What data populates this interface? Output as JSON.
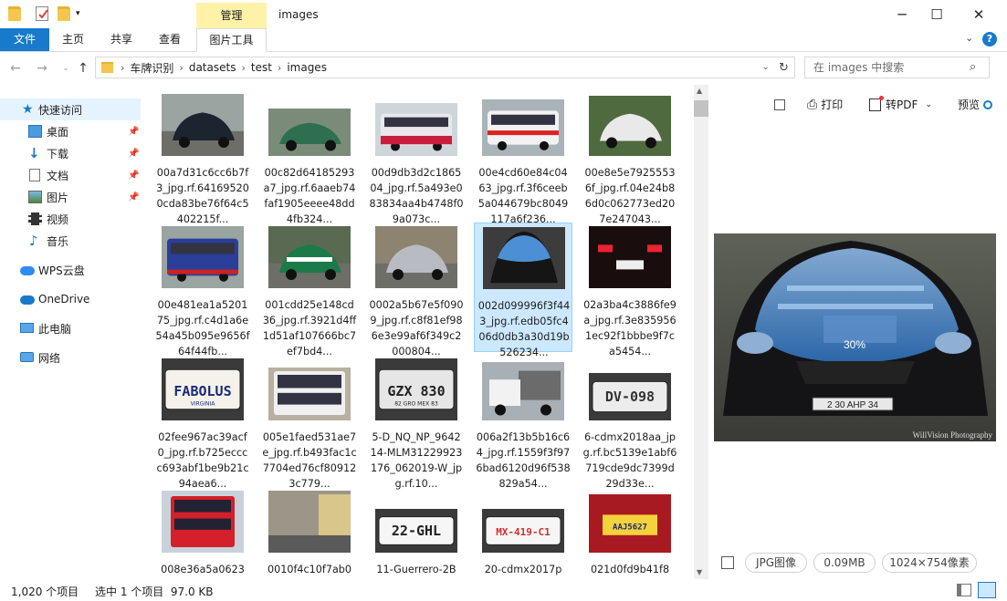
{
  "window": {
    "title": "images",
    "context_tab": "管理",
    "controls": [
      "─",
      "☐",
      "✕"
    ]
  },
  "ribbon": {
    "tabs": [
      "文件",
      "主页",
      "共享",
      "查看",
      "图片工具"
    ]
  },
  "address": {
    "crumbs": [
      "车牌识别",
      "datasets",
      "test",
      "images"
    ],
    "search_placeholder": "在 images 中搜索"
  },
  "sidebar": {
    "items": [
      {
        "label": "快速访问",
        "icon": "star-icon",
        "pinned": false
      },
      {
        "label": "桌面",
        "icon": "desktop-icon",
        "pinned": true
      },
      {
        "label": "下载",
        "icon": "download-icon",
        "pinned": true
      },
      {
        "label": "文档",
        "icon": "document-icon",
        "pinned": true
      },
      {
        "label": "图片",
        "icon": "picture-icon",
        "pinned": true
      },
      {
        "label": "视频",
        "icon": "video-icon",
        "pinned": false
      },
      {
        "label": "音乐",
        "icon": "music-icon",
        "pinned": false
      },
      {
        "label": "WPS云盘",
        "icon": "cloud-icon",
        "pinned": false
      },
      {
        "label": "OneDrive",
        "icon": "onedrive-icon",
        "pinned": false
      },
      {
        "label": "此电脑",
        "icon": "computer-icon",
        "pinned": false
      },
      {
        "label": "网络",
        "icon": "network-icon",
        "pinned": false
      }
    ]
  },
  "files": [
    {
      "name": "00a7d31c6cc6b7f3_jpg.rf.641695200cda83be76f64c5402215f...",
      "thumb": "car-dark"
    },
    {
      "name": "00c82d64185293a7_jpg.rf.6aaeb74faf1905eeee48dd4fb324...",
      "thumb": "car-green"
    },
    {
      "name": "00d9db3d2c186504_jpg.rf.5a493e083834aa4b4748f09a073c...",
      "thumb": "bus-red"
    },
    {
      "name": "00e4cd60e84c0463_jpg.rf.3f6ceeb5a044679bc8049117a6f236...",
      "thumb": "bus-white"
    },
    {
      "name": "00e8e5e79255536f_jpg.rf.04e24b86d0c062773ed207e247043...",
      "thumb": "car-white"
    },
    {
      "name": "00e481ea1a520175_jpg.rf.c4d1a6e54a45b095e9656f64f44fb...",
      "thumb": "bus-blue"
    },
    {
      "name": "001cdd25e148cd36_jpg.rf.3921d4ff1d51af107666bc7ef7bd4...",
      "thumb": "car-police"
    },
    {
      "name": "0002a5b67e5f0909_jpg.rf.c8f81ef986e3e99af6f349c2000804...",
      "thumb": "car-street"
    },
    {
      "name": "002d099996f3f443_jpg.rf.edb05fc406d0db3a30d19b526234...",
      "thumb": "car-hood"
    },
    {
      "name": "02a3ba4c3886fe9a_jpg.rf.3e8359561ec92f1bbbe9f7ca5454...",
      "thumb": "plate-night"
    },
    {
      "name": "02fee967ac39acf0_jpg.rf.b725ecccc693abf1be9b21c94aea6...",
      "thumb": "plate-fabolus"
    },
    {
      "name": "005e1faed531ae7e_jpg.rf.b493fac1c7704ed76cf809123c779...",
      "thumb": "bus-double"
    },
    {
      "name": "5-D_NQ_NP_964214-MLM31229923176_062019-W_jpg.rf.10...",
      "thumb": "plate-gzx"
    },
    {
      "name": "006a2f13b5b16c64_jpg.rf.1559f3f976bad6120d96f538829a54...",
      "thumb": "truck"
    },
    {
      "name": "6-cdmx2018aa_jpg.rf.bc5139e1abf6719cde9dc7399d29d33e...",
      "thumb": "plate-dv"
    },
    {
      "name": "008e36a5a0623",
      "thumb": "bus-red2"
    },
    {
      "name": "0010f4c10f7ab0",
      "thumb": "street"
    },
    {
      "name": "11-Guerrero-2B",
      "thumb": "plate-22ghl"
    },
    {
      "name": "20-cdmx2017p",
      "thumb": "plate-mx419"
    },
    {
      "name": "021d0fd9b41f8",
      "thumb": "plate-aaj"
    }
  ],
  "plates": {
    "fabolus": "FABOLUS",
    "fabolus_state": "VIRGINIA",
    "gzx": "GZX 830",
    "gzx_sub": "82 GRO MEX 83",
    "dv": "DV-098",
    "ghl": "22-GHL",
    "mx": "MX-419-C1",
    "aaj": "AAJ5627"
  },
  "preview": {
    "tools": {
      "print": "打印",
      "pdf": "转PDF",
      "preview": "预览"
    },
    "zoom": "30%",
    "watermark": "WillVision Photography",
    "plate_text": "2 30 AHP 34",
    "meta": {
      "type": "JPG图像",
      "size": "0.09MB",
      "dims": "1024×754像素"
    }
  },
  "status": {
    "count": "1,020 个项目",
    "selection": "选中 1 个项目  97.0 KB"
  },
  "colors": {
    "accent": "#1979ca",
    "selection": "#cce8ff",
    "context_tab": "#fdf2a8"
  }
}
